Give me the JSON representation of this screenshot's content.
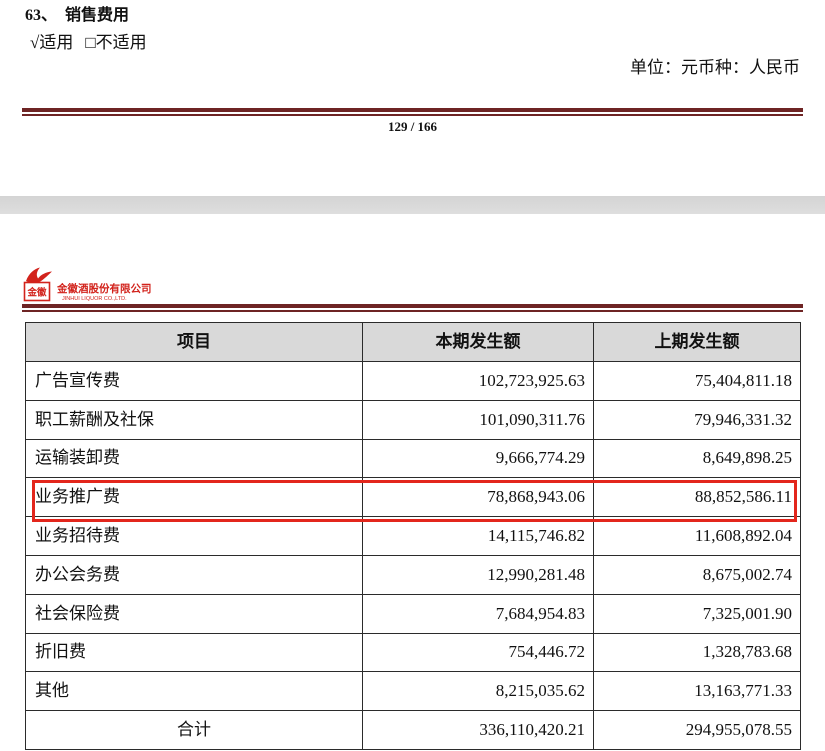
{
  "prev_page": {
    "section_number": "63、",
    "section_title": "销售费用",
    "applicable_label": "√适用",
    "not_applicable_label": "□不适用",
    "unit_label": "单位：元币种：人民币",
    "footer_page_number": "129 / 166"
  },
  "next_page": {
    "logo_mark": "金徽",
    "company_name_cn": "金徽酒股份有限公司",
    "company_name_en": "JINHUI LIQUOR CO.,LTD."
  },
  "table": {
    "headers": {
      "item": "项目",
      "current": "本期发生额",
      "previous": "上期发生额"
    },
    "rows": [
      {
        "item": "广告宣传费",
        "current": "102,723,925.63",
        "previous": "75,404,811.18"
      },
      {
        "item": "职工薪酬及社保",
        "current": "101,090,311.76",
        "previous": "79,946,331.32"
      },
      {
        "item": "运输装卸费",
        "current": "9,666,774.29",
        "previous": "8,649,898.25"
      },
      {
        "item": "业务推广费",
        "current": "78,868,943.06",
        "previous": "88,852,586.11",
        "highlighted": true
      },
      {
        "item": "业务招待费",
        "current": "14,115,746.82",
        "previous": "11,608,892.04"
      },
      {
        "item": "办公会务费",
        "current": "12,990,281.48",
        "previous": "8,675,002.74"
      },
      {
        "item": "社会保险费",
        "current": "7,684,954.83",
        "previous": "7,325,001.90"
      },
      {
        "item": "折旧费",
        "current": "754,446.72",
        "previous": "1,328,783.68"
      },
      {
        "item": "其他",
        "current": "8,215,035.62",
        "previous": "13,163,771.33"
      }
    ],
    "total": {
      "item": "合计",
      "current": "336,110,420.21",
      "previous": "294,955,078.55"
    }
  },
  "colors": {
    "rule": "#6e2424",
    "header_bg": "#d9d9d9",
    "highlight": "#e3261c",
    "brand": "#d2231c",
    "page_gap": "#dadada"
  }
}
